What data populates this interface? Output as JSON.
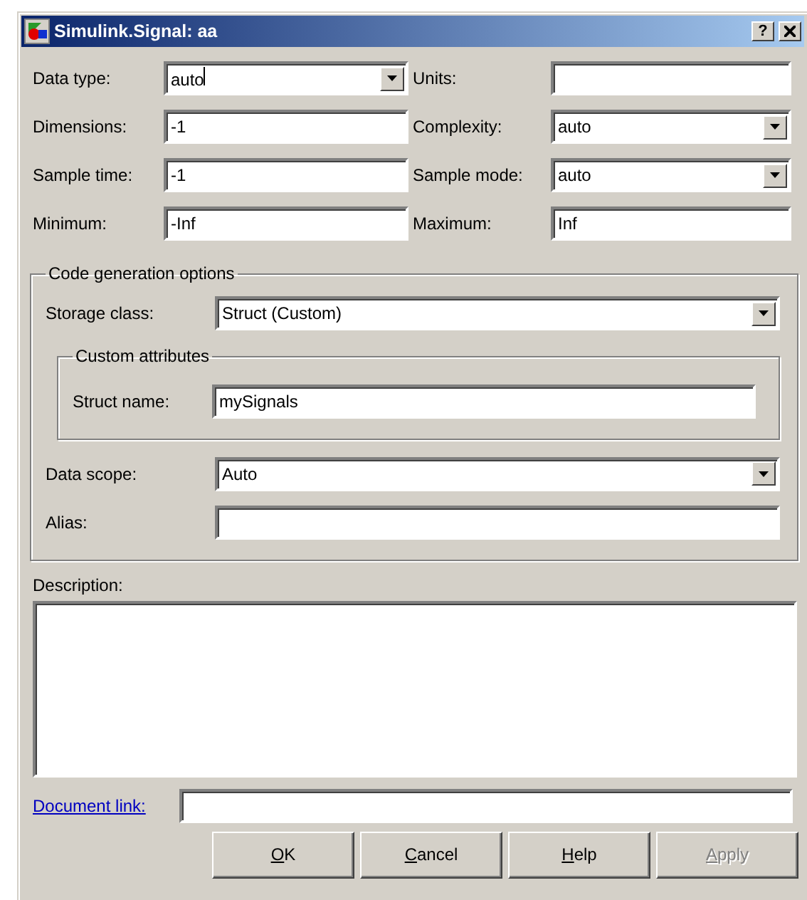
{
  "window": {
    "title": "Simulink.Signal: aa",
    "help_glyph": "?"
  },
  "fields": [
    {
      "label": "Data type:",
      "value": "auto",
      "kind": "combo",
      "editable": true
    },
    {
      "label": "Units:",
      "kind": "text"
    },
    {
      "label": "Dimensions:",
      "value": "-1",
      "kind": "text"
    },
    {
      "label": "Complexity:",
      "value": "auto",
      "kind": "combo",
      "editable": false
    },
    {
      "label": "Sample time:",
      "value": "-1",
      "kind": "text"
    },
    {
      "label": "Sample mode:",
      "value": "auto",
      "kind": "combo",
      "editable": false
    },
    {
      "label": "Minimum:",
      "value": "-Inf",
      "kind": "text"
    },
    {
      "label": "Maximum:",
      "value": "Inf",
      "kind": "text"
    }
  ],
  "code_generation": {
    "title": "Code generation options",
    "storage_class": {
      "label": "Storage class:",
      "value": "Struct (Custom)",
      "kind": "combo"
    },
    "custom_attributes": {
      "title": "Custom attributes",
      "struct_name": {
        "label": "Struct name:",
        "value": "mySignals",
        "kind": "text"
      }
    },
    "data_scope": {
      "label": "Data scope:",
      "value": "Auto",
      "kind": "combo"
    },
    "alias": {
      "label": "Alias:",
      "kind": "text"
    }
  },
  "description": {
    "label": "Description:"
  },
  "document_link": {
    "label": "Document link:",
    "kind": "text"
  },
  "buttons": [
    {
      "label": "OK",
      "disabled": false,
      "underline_first": true
    },
    {
      "label": "Cancel",
      "disabled": false,
      "underline_first": true
    },
    {
      "label": "Help",
      "disabled": false,
      "underline_first": true
    },
    {
      "label": "Apply",
      "disabled": true,
      "underline_first": true
    }
  ]
}
